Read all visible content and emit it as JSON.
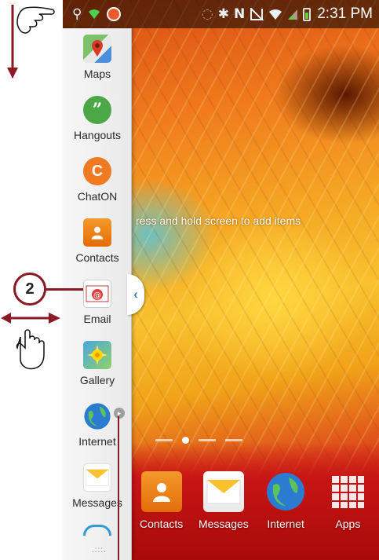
{
  "status_bar": {
    "time": "2:31 PM",
    "left_icons": [
      "usb-icon",
      "wifi-signal-icon",
      "chaton-notification-icon"
    ],
    "right_icons": [
      "bluetooth-icon",
      "nfc-icon",
      "mute-icon",
      "wifi-icon",
      "signal-icon",
      "battery-icon"
    ]
  },
  "home": {
    "hint": "ress and hold screen to add items"
  },
  "tray": {
    "items": [
      {
        "label": "Maps",
        "icon": "maps-icon"
      },
      {
        "label": "Hangouts",
        "icon": "hangouts-icon"
      },
      {
        "label": "ChatON",
        "icon": "chaton-icon"
      },
      {
        "label": "Contacts",
        "icon": "contacts-icon"
      },
      {
        "label": "Email",
        "icon": "email-icon"
      },
      {
        "label": "Gallery",
        "icon": "gallery-icon"
      },
      {
        "label": "Internet",
        "icon": "internet-icon"
      },
      {
        "label": "Messages",
        "icon": "messages-icon"
      }
    ],
    "handle_glyph": "‹"
  },
  "dock": {
    "items": [
      {
        "label": "Contacts",
        "icon": "contacts-icon"
      },
      {
        "label": "Messages",
        "icon": "messages-icon"
      },
      {
        "label": "Internet",
        "icon": "internet-icon"
      },
      {
        "label": "Apps",
        "icon": "apps-grid-icon"
      }
    ]
  },
  "annotation": {
    "callout_number": "2"
  },
  "colors": {
    "callout_border": "#8b1a27",
    "tray_bg": "#f2f2f2",
    "accent_blue": "#3b7fc4"
  }
}
